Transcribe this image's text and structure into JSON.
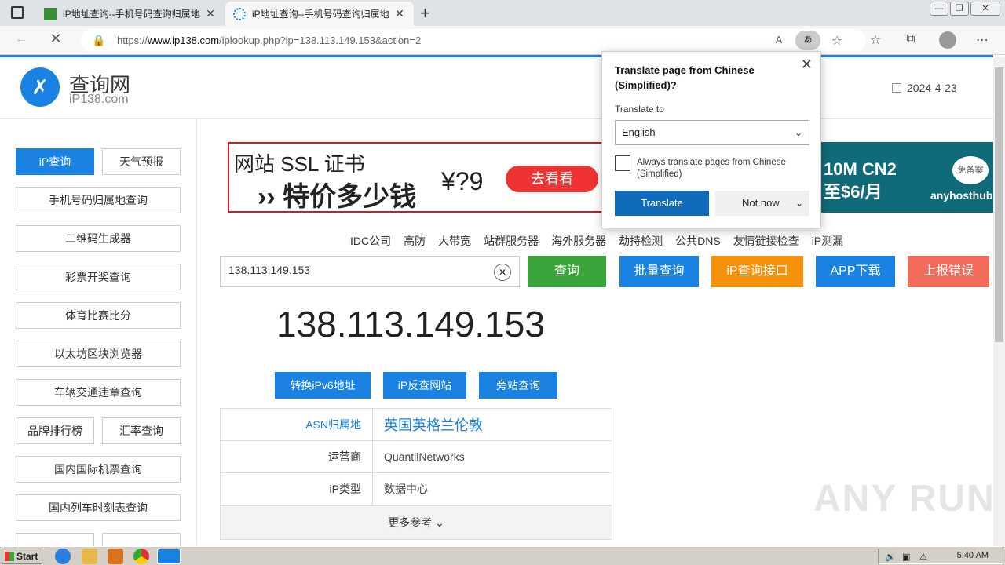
{
  "browser": {
    "tabs": [
      {
        "title": "iP地址查询--手机号码查询归属地",
        "active": false
      },
      {
        "title": "iP地址查询--手机号码查询归属地",
        "active": true
      }
    ],
    "url_prefix": "https://",
    "url_domain": "www.ip138.com",
    "url_path": "/iplookup.php?ip=138.113.149.153&action=2"
  },
  "header": {
    "logo_title": "查询网",
    "logo_sub": "iP138.com",
    "date": "2024-4-23"
  },
  "sidebar": {
    "items": [
      {
        "label": "iP查询",
        "selected": true
      },
      {
        "label": "天气预报"
      },
      {
        "label": "手机号码归属地查询"
      },
      {
        "label": "二维码生成器"
      },
      {
        "label": "彩票开奖查询"
      },
      {
        "label": "体育比赛比分"
      },
      {
        "label": "以太坊区块浏览器"
      },
      {
        "label": "车辆交通违章查询"
      },
      {
        "label": "品牌排行榜"
      },
      {
        "label": "汇率查询"
      },
      {
        "label": "国内国际机票查询"
      },
      {
        "label": "国内列车时刻表查询"
      }
    ]
  },
  "banner": {
    "line1": "网站 SSL 证书",
    "line2": "›› 特价多少钱",
    "price": "¥?9",
    "button": "去看看"
  },
  "banner2": {
    "line1": "10M CN2",
    "line2": "至$6/月",
    "brand": "anyhosthub",
    "stamp": "免备案"
  },
  "links": [
    "IDC公司",
    "高防",
    "大带宽",
    "站群服务器",
    "海外服务器",
    "劫持检测",
    "公共DNS",
    "友情链接检查",
    "iP测漏"
  ],
  "search": {
    "value": "138.113.149.153",
    "buttons": [
      {
        "label": "查询",
        "color": "#3aa53a"
      },
      {
        "label": "批量查询",
        "color": "#1a82e2"
      },
      {
        "label": "iP查询接口",
        "color": "#f5900a"
      },
      {
        "label": "APP下载",
        "color": "#1a82e2"
      },
      {
        "label": "上报错误",
        "color": "#f26b5b"
      }
    ]
  },
  "result": {
    "ip": "138.113.149.153",
    "actions": [
      "转换iPv6地址",
      "iP反查网站",
      "旁站查询"
    ],
    "rows": [
      {
        "key": "ASN归属地",
        "value": "英国英格兰伦敦"
      },
      {
        "key": "运营商",
        "value": "QuantilNetworks"
      },
      {
        "key": "iP类型",
        "value": "数据中心"
      }
    ],
    "more": "更多参考"
  },
  "translate": {
    "title": "Translate page from Chinese (Simplified)?",
    "to_label": "Translate to",
    "language": "English",
    "always_label": "Always translate pages from Chinese (Simplified)",
    "translate_btn": "Translate",
    "notnow_btn": "Not now"
  },
  "watermark": "ANY RUN",
  "taskbar": {
    "start": "Start",
    "clock": "5:40 AM"
  }
}
